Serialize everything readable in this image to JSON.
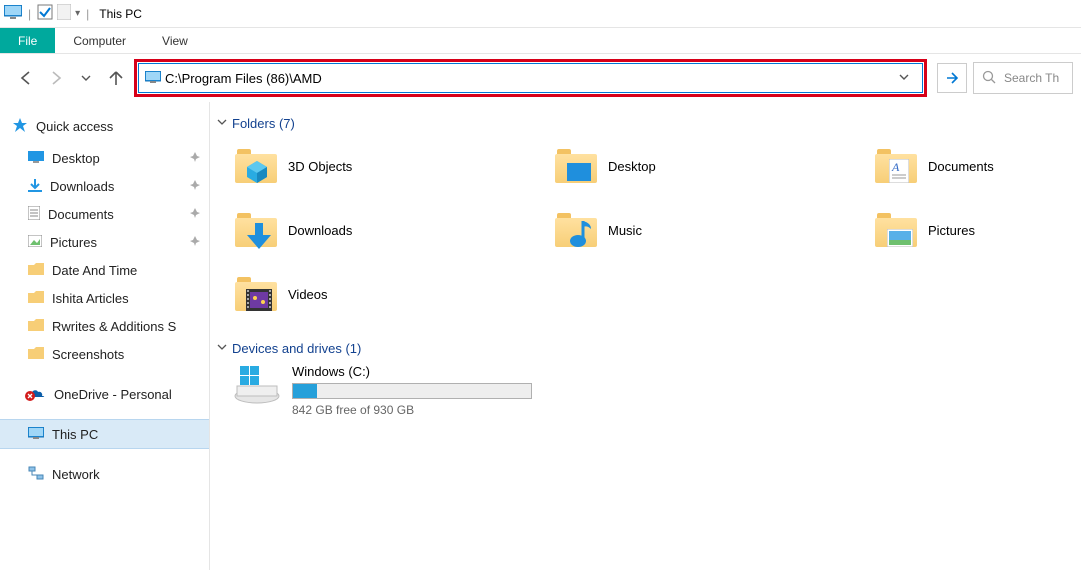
{
  "title_bar": {
    "title": "This PC"
  },
  "menu": {
    "file": "File",
    "computer": "Computer",
    "view": "View"
  },
  "address": {
    "value": "C:\\Program Files (86)\\AMD",
    "search_placeholder": "Search Th"
  },
  "sidebar": {
    "quick_access": "Quick access",
    "items": [
      {
        "label": "Desktop",
        "pinned": true
      },
      {
        "label": "Downloads",
        "pinned": true
      },
      {
        "label": "Documents",
        "pinned": true
      },
      {
        "label": "Pictures",
        "pinned": true
      },
      {
        "label": "Date And Time",
        "pinned": false
      },
      {
        "label": "Ishita Articles",
        "pinned": false
      },
      {
        "label": "Rwrites & Additions S",
        "pinned": false
      },
      {
        "label": "Screenshots",
        "pinned": false
      }
    ],
    "onedrive": "OneDrive - Personal",
    "this_pc": "This PC",
    "network": "Network"
  },
  "folders_header": "Folders (7)",
  "folders": [
    {
      "label": "3D Objects"
    },
    {
      "label": "Desktop"
    },
    {
      "label": "Documents"
    },
    {
      "label": "Downloads"
    },
    {
      "label": "Music"
    },
    {
      "label": "Pictures"
    },
    {
      "label": "Videos"
    }
  ],
  "drives_header": "Devices and drives (1)",
  "drive": {
    "label": "Windows (C:)",
    "free_text": "842 GB free of 930 GB"
  }
}
